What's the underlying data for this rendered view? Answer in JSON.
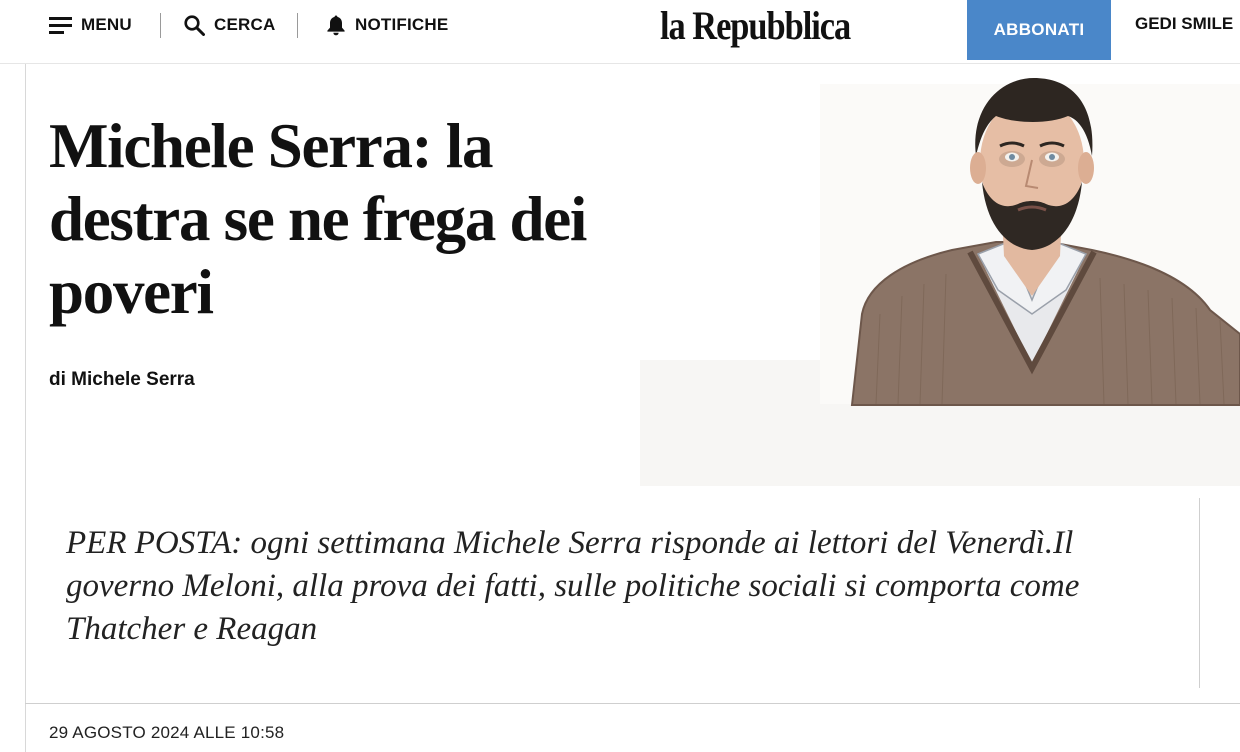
{
  "header": {
    "menu_label": "MENU",
    "search_label": "CERCA",
    "notifications_label": "NOTIFICHE",
    "logo_text": "la Repubblica",
    "subscribe_label": "ABBONATI",
    "gedi_label": "GEDI SMILE",
    "icons": [
      "menu-icon",
      "search-icon",
      "bell-icon"
    ],
    "accent_color": "#4a87c9"
  },
  "article": {
    "headline": "Michele Serra: la destra se ne frega dei poveri",
    "byline_prefix": "di",
    "author": "Michele Serra",
    "summary": "PER POSTA: ogni settimana Michele Serra risponde ai lettori del Venerdì.Il governo Meloni, alla prova dei fatti, sulle politiche sociali si comporta come Thatcher e Reagan",
    "date": "29 AGOSTO 2024 ALLE 10:58",
    "illustration": "author-portrait-illustration"
  }
}
